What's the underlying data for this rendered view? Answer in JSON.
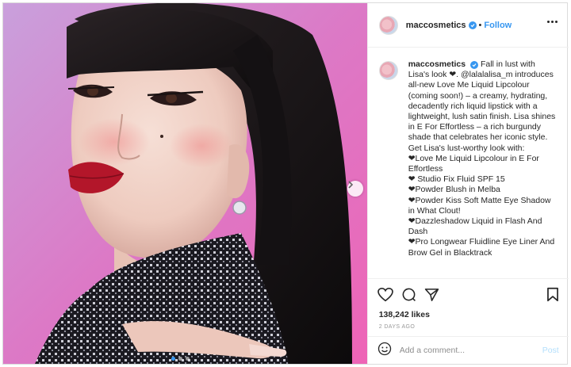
{
  "post": {
    "username": "maccosmetics",
    "separator": "•",
    "follow_label": "Follow",
    "more_icon": "more-dots-icon",
    "verified_icon": "verified-badge-icon"
  },
  "media": {
    "next_icon": "chevron-right-icon",
    "carousel_count": 3,
    "carousel_active": 1
  },
  "caption": {
    "username": "maccosmetics",
    "lines": [
      "Fall in lust with Lisa's look ❤. @lalalalisa_m introduces all-new Love Me Liquid Lipcolour (coming soon!) – a creamy, hydrating, decadently rich liquid lipstick with a lightweight, lush satin finish. Lisa shines in E For Effortless – a rich burgundy shade that celebrates her iconic style. Get Lisa's lust-worthy look with:",
      "❤Love Me Liquid Lipcolour in E For Effortless",
      "❤ Studio Fix Fluid SPF 15",
      "❤Powder Blush in Melba",
      "❤Powder Kiss Soft Matte Eye Shadow in What Clout!",
      "❤Dazzleshadow Liquid in Flash And Dash",
      "❤Pro Longwear Fluidline Eye Liner And Brow Gel in Blacktrack"
    ]
  },
  "actions": {
    "like_icon": "heart-icon",
    "comment_icon": "comment-icon",
    "share_icon": "share-icon",
    "save_icon": "bookmark-icon"
  },
  "likes_text": "138,242 likes",
  "age_text": "2 DAYS AGO",
  "comment": {
    "emoji_icon": "smiley-icon",
    "placeholder": "Add a comment...",
    "post_label": "Post"
  },
  "colors": {
    "accent": "#3897f0",
    "post_disabled": "#b2dffc",
    "border": "#dbdbdb"
  }
}
